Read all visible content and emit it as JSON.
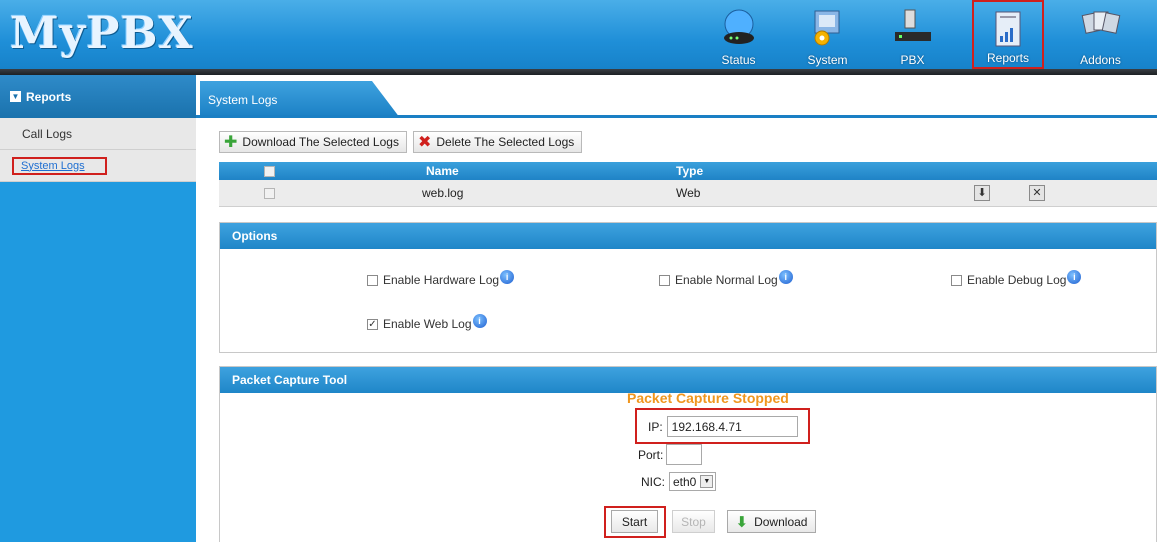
{
  "header": {
    "logo": "MyPBX",
    "nav": [
      {
        "label": "Status",
        "icon": "status-icon"
      },
      {
        "label": "System",
        "icon": "system-icon"
      },
      {
        "label": "PBX",
        "icon": "pbx-icon"
      },
      {
        "label": "Reports",
        "icon": "reports-icon",
        "active": true
      },
      {
        "label": "Addons",
        "icon": "addons-icon"
      }
    ]
  },
  "sidebar": {
    "title": "Reports",
    "items": [
      {
        "label": "Call Logs"
      },
      {
        "label": "System Logs",
        "selected": true
      }
    ]
  },
  "tab": {
    "label": "System Logs"
  },
  "toolbar": {
    "download_label": "Download The Selected Logs",
    "delete_label": "Delete The Selected Logs"
  },
  "grid": {
    "columns": [
      "Name",
      "Type"
    ],
    "rows": [
      {
        "name": "web.log",
        "type": "Web"
      }
    ]
  },
  "options": {
    "title": "Options",
    "items": [
      {
        "label": "Enable Hardware Log",
        "checked": false
      },
      {
        "label": "Enable Normal Log",
        "checked": false
      },
      {
        "label": "Enable Debug Log",
        "checked": false
      },
      {
        "label": "Enable Web Log",
        "checked": true
      }
    ]
  },
  "capture": {
    "title": "Packet Capture Tool",
    "status": "Packet Capture Stopped",
    "ip_label": "IP:",
    "ip_value": "192.168.4.71",
    "port_label": "Port:",
    "port_value": "",
    "nic_label": "NIC:",
    "nic_value": "eth0",
    "start_label": "Start",
    "stop_label": "Stop",
    "download_label": "Download"
  },
  "colors": {
    "accent": "#1f9ae0",
    "highlight": "#d0201d",
    "status": "#f0961e"
  }
}
